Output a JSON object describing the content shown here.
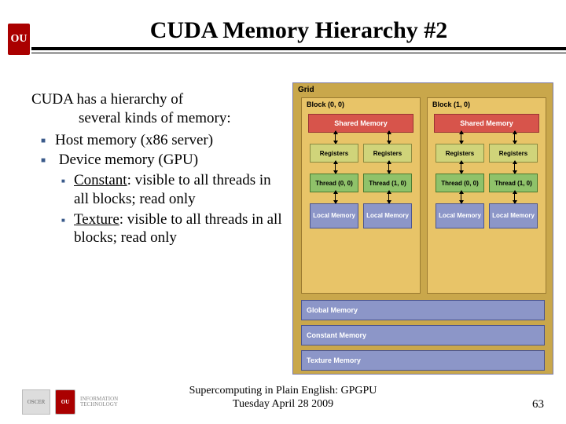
{
  "header": {
    "logo_text": "OU",
    "title": "CUDA Memory Hierarchy #2"
  },
  "content": {
    "intro_line1": "CUDA has a hierarchy of",
    "intro_line2": "several kinds of memory:",
    "items": [
      {
        "label": "Host memory (x86 server)"
      },
      {
        "label": "Device memory (GPU)",
        "sub": [
          {
            "term": "Constant",
            "rest": ": visible to all threads in all blocks; read only"
          },
          {
            "term": "Texture",
            "rest": ": visible to all threads in all blocks; read only"
          }
        ]
      }
    ]
  },
  "diagram": {
    "grid_label": "Grid",
    "blocks": [
      {
        "label": "Block (0, 0)"
      },
      {
        "label": "Block (1, 0)"
      }
    ],
    "shared_label": "Shared Memory",
    "register_label": "Registers",
    "threads": {
      "t00": "Thread (0, 0)",
      "t10": "Thread (1, 0)"
    },
    "local_label": "Local Memory",
    "global_label": "Global Memory",
    "constant_label": "Constant Memory",
    "texture_label": "Texture Memory"
  },
  "footer": {
    "line1": "Supercomputing in Plain English: GPGPU",
    "line2": "Tuesday April 28 2009",
    "page": "63",
    "logos": {
      "oscer": "OSCER",
      "ou": "OU",
      "it": "INFORMATION TECHNOLOGY"
    }
  }
}
